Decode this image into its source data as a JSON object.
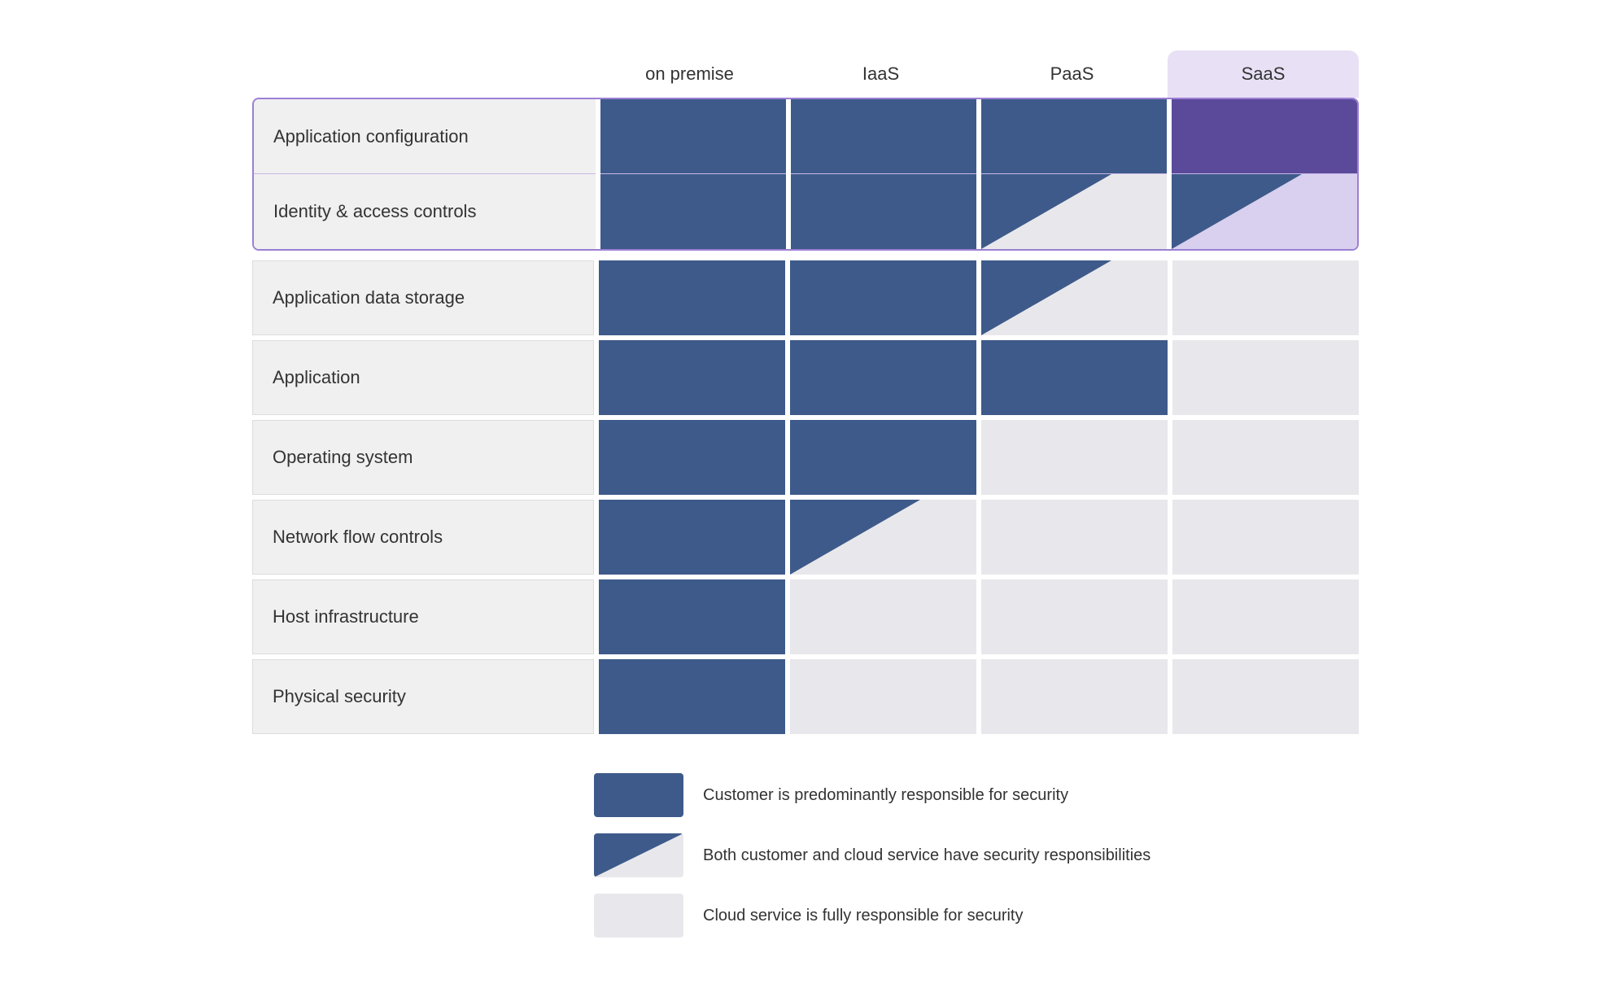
{
  "header": {
    "columns": [
      {
        "id": "on-premise",
        "label": "on premise",
        "highlight": false
      },
      {
        "id": "iaas",
        "label": "IaaS",
        "highlight": false
      },
      {
        "id": "paas",
        "label": "PaaS",
        "highlight": false
      },
      {
        "id": "saas",
        "label": "SaaS",
        "highlight": true
      }
    ]
  },
  "rows": [
    {
      "group": "highlighted",
      "items": [
        {
          "label": "Application configuration",
          "cells": [
            "blue",
            "blue",
            "blue",
            "blue-saas"
          ]
        },
        {
          "label": "Identity & access controls",
          "cells": [
            "blue",
            "blue",
            "split",
            "split-saas"
          ]
        }
      ]
    },
    {
      "group": "normal",
      "items": [
        {
          "label": "Application data storage",
          "cells": [
            "blue",
            "blue",
            "split",
            "grey"
          ]
        },
        {
          "label": "Application",
          "cells": [
            "blue",
            "blue",
            "blue",
            "grey"
          ]
        },
        {
          "label": "Operating system",
          "cells": [
            "blue",
            "blue",
            "grey",
            "grey"
          ]
        },
        {
          "label": "Network flow controls",
          "cells": [
            "blue",
            "split",
            "grey",
            "grey"
          ]
        },
        {
          "label": "Host infrastructure",
          "cells": [
            "blue",
            "grey",
            "grey",
            "grey"
          ]
        },
        {
          "label": "Physical security",
          "cells": [
            "blue",
            "grey",
            "grey",
            "grey"
          ]
        }
      ]
    }
  ],
  "legend": [
    {
      "type": "blue",
      "text": "Customer is predominantly responsible for security"
    },
    {
      "type": "split",
      "text": "Both customer and cloud service have security responsibilities"
    },
    {
      "type": "grey",
      "text": "Cloud service is fully responsible for security"
    }
  ]
}
